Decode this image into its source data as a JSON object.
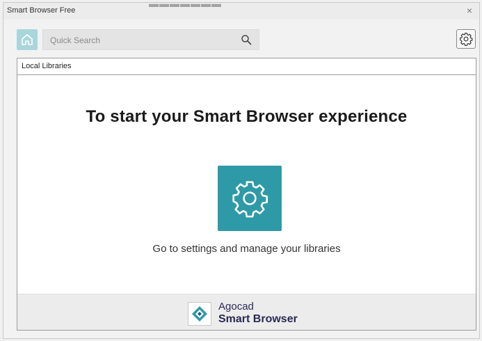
{
  "window": {
    "title": "Smart Browser Free",
    "top_partial_text": "▬▬▬▬▬▬▬",
    "close_label": "×"
  },
  "toolbar": {
    "search_placeholder": "Quick Search",
    "home_icon": "home-icon",
    "search_icon": "search-icon",
    "settings_icon": "gear-icon"
  },
  "panel": {
    "header_title": "Local Libraries",
    "heading": "To start your Smart Browser experience",
    "settings_icon": "gear-icon",
    "subtext": "Go to settings and manage your libraries"
  },
  "footer": {
    "company": "Agocad",
    "product": "Smart Browser"
  },
  "colors": {
    "accent": "#2f9aa7",
    "home_button": "#a9d6dc",
    "brand_text": "#2a2a55"
  }
}
